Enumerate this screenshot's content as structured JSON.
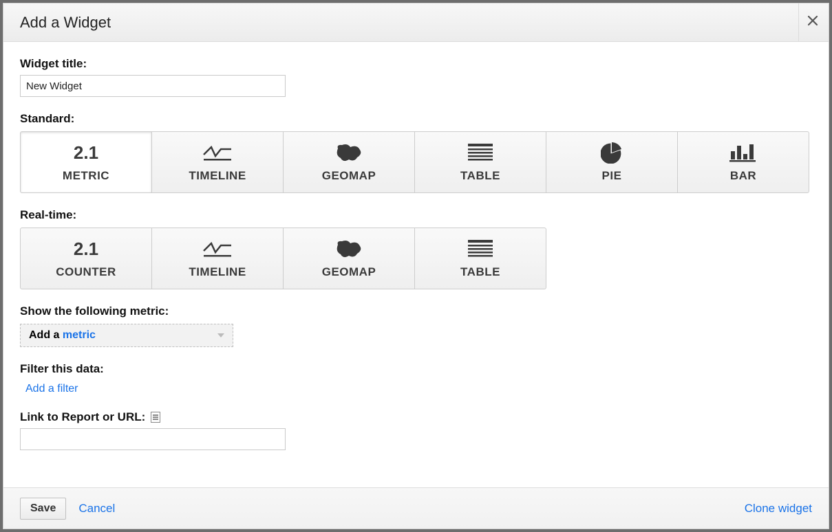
{
  "dialog": {
    "title": "Add a Widget"
  },
  "fields": {
    "title_label": "Widget title:",
    "title_value": "New Widget",
    "standard_label": "Standard:",
    "realtime_label": "Real-time:",
    "metric_label": "Show the following metric:",
    "metric_dropdown_prefix": "Add a ",
    "metric_dropdown_link": "metric",
    "filter_label": "Filter this data:",
    "filter_action": "Add a filter",
    "url_label": "Link to Report or URL:",
    "url_value": ""
  },
  "standard_types": [
    {
      "id": "metric",
      "label": "METRIC",
      "icon": "metric-number-icon",
      "selected": true
    },
    {
      "id": "timeline",
      "label": "TIMELINE",
      "icon": "timeline-icon"
    },
    {
      "id": "geomap",
      "label": "GEOMAP",
      "icon": "geomap-icon"
    },
    {
      "id": "table",
      "label": "TABLE",
      "icon": "table-icon"
    },
    {
      "id": "pie",
      "label": "PIE",
      "icon": "pie-icon"
    },
    {
      "id": "bar",
      "label": "BAR",
      "icon": "bar-icon"
    }
  ],
  "realtime_types": [
    {
      "id": "counter",
      "label": "COUNTER",
      "icon": "metric-number-icon"
    },
    {
      "id": "timeline",
      "label": "TIMELINE",
      "icon": "timeline-icon"
    },
    {
      "id": "geomap",
      "label": "GEOMAP",
      "icon": "geomap-icon"
    },
    {
      "id": "table",
      "label": "TABLE",
      "icon": "table-icon"
    }
  ],
  "footer": {
    "save": "Save",
    "cancel": "Cancel",
    "clone": "Clone widget"
  },
  "icon_glyphs": {
    "metric_number": "2.1"
  }
}
